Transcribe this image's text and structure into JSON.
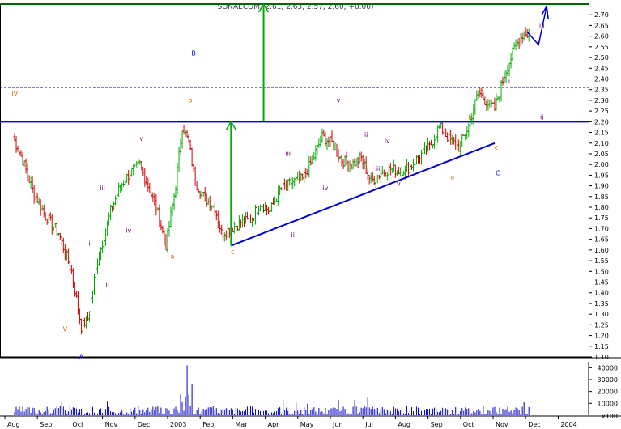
{
  "chart_data": {
    "type": "ohlc-candlestick",
    "title": "SONAECOM (2.61, 2.63, 2.57, 2.60, +0.00)",
    "y_axis": {
      "min": 1.1,
      "max": 2.7,
      "step": 0.05,
      "ticks": [
        "2.70",
        "2.65",
        "2.60",
        "2.55",
        "2.50",
        "2.45",
        "2.40",
        "2.35",
        "2.30",
        "2.25",
        "2.20",
        "2.15",
        "2.10",
        "2.05",
        "2.00",
        "1.95",
        "1.90",
        "1.85",
        "1.80",
        "1.75",
        "1.70",
        "1.65",
        "1.60",
        "1.55",
        "1.50",
        "1.45",
        "1.40",
        "1.35",
        "1.30",
        "1.25",
        "1.20",
        "1.15",
        "1.10"
      ]
    },
    "volume_axis": {
      "min": 0,
      "max": 45000,
      "ticks": [
        "40000",
        "30000",
        "20000",
        "10000"
      ],
      "multiplier_label": "x100"
    },
    "x_axis": {
      "labels": [
        "Aug",
        "Sep",
        "Oct",
        "Nov",
        "Dec",
        "2003",
        "Feb",
        "Mar",
        "Apr",
        "May",
        "Jun",
        "Jul",
        "Aug",
        "Sep",
        "Oct",
        "Nov",
        "Dec",
        "2004"
      ]
    },
    "price_series_anchors": [
      {
        "m": 0.0,
        "p": 2.13
      },
      {
        "m": 0.3,
        "p": 2.02
      },
      {
        "m": 0.6,
        "p": 1.88
      },
      {
        "m": 1.0,
        "p": 1.76
      },
      {
        "m": 1.4,
        "p": 1.68
      },
      {
        "m": 1.8,
        "p": 1.5
      },
      {
        "m": 2.1,
        "p": 1.24
      },
      {
        "m": 2.3,
        "p": 1.28
      },
      {
        "m": 2.6,
        "p": 1.55
      },
      {
        "m": 3.0,
        "p": 1.78
      },
      {
        "m": 3.3,
        "p": 1.9
      },
      {
        "m": 3.6,
        "p": 1.96
      },
      {
        "m": 3.9,
        "p": 2.0
      },
      {
        "m": 4.1,
        "p": 1.92
      },
      {
        "m": 4.4,
        "p": 1.8
      },
      {
        "m": 4.7,
        "p": 1.62
      },
      {
        "m": 5.0,
        "p": 1.9
      },
      {
        "m": 5.2,
        "p": 2.18
      },
      {
        "m": 5.4,
        "p": 2.1
      },
      {
        "m": 5.6,
        "p": 1.92
      },
      {
        "m": 5.9,
        "p": 1.84
      },
      {
        "m": 6.2,
        "p": 1.8
      },
      {
        "m": 6.4,
        "p": 1.68
      },
      {
        "m": 6.7,
        "p": 1.7
      },
      {
        "m": 7.0,
        "p": 1.73
      },
      {
        "m": 7.3,
        "p": 1.74
      },
      {
        "m": 7.6,
        "p": 1.82
      },
      {
        "m": 7.9,
        "p": 1.78
      },
      {
        "m": 8.2,
        "p": 1.88
      },
      {
        "m": 8.6,
        "p": 1.92
      },
      {
        "m": 8.9,
        "p": 1.93
      },
      {
        "m": 9.2,
        "p": 2.02
      },
      {
        "m": 9.5,
        "p": 2.13
      },
      {
        "m": 9.8,
        "p": 2.1
      },
      {
        "m": 10.1,
        "p": 2.02
      },
      {
        "m": 10.4,
        "p": 2.0
      },
      {
        "m": 10.7,
        "p": 2.03
      },
      {
        "m": 11.0,
        "p": 1.92
      },
      {
        "m": 11.3,
        "p": 1.96
      },
      {
        "m": 11.6,
        "p": 1.98
      },
      {
        "m": 11.9,
        "p": 1.97
      },
      {
        "m": 12.2,
        "p": 1.99
      },
      {
        "m": 12.5,
        "p": 2.04
      },
      {
        "m": 12.8,
        "p": 2.08
      },
      {
        "m": 13.1,
        "p": 2.18
      },
      {
        "m": 13.4,
        "p": 2.12
      },
      {
        "m": 13.7,
        "p": 2.08
      },
      {
        "m": 14.0,
        "p": 2.18
      },
      {
        "m": 14.3,
        "p": 2.34
      },
      {
        "m": 14.5,
        "p": 2.3
      },
      {
        "m": 14.8,
        "p": 2.26
      },
      {
        "m": 15.1,
        "p": 2.42
      },
      {
        "m": 15.4,
        "p": 2.54
      },
      {
        "m": 15.7,
        "p": 2.62
      },
      {
        "m": 15.9,
        "p": 2.6
      }
    ],
    "horizontal_lines": [
      {
        "name": "resistance",
        "price": 2.2,
        "style": "solid",
        "color": "#0000cc"
      },
      {
        "name": "target",
        "price": 2.75,
        "style": "solid",
        "color": "#006600"
      },
      {
        "name": "prior-high",
        "price": 2.36,
        "style": "dashed",
        "color": "#000066"
      }
    ],
    "trendline": {
      "from": {
        "m": 6.7,
        "p": 1.62
      },
      "to": {
        "m": 14.8,
        "p": 2.1
      },
      "color": "#0000cc"
    },
    "projection_arrows": [
      {
        "m": 6.7,
        "from": 1.62,
        "to": 2.2
      },
      {
        "m": 7.7,
        "from": 2.2,
        "to": 2.75
      }
    ],
    "wave_labels": [
      {
        "text": "IV",
        "m": 0.05,
        "p": 2.32,
        "color": "#cc6600"
      },
      {
        "text": "V",
        "m": 1.6,
        "p": 1.22,
        "color": "#cc6600"
      },
      {
        "text": "A",
        "m": 2.1,
        "p": 1.09,
        "color": "#0000cc"
      },
      {
        "text": "i",
        "m": 2.35,
        "p": 1.62,
        "color": "#660066"
      },
      {
        "text": "ii",
        "m": 2.9,
        "p": 1.43,
        "color": "#660066"
      },
      {
        "text": "iii",
        "m": 2.75,
        "p": 1.88,
        "color": "#660066"
      },
      {
        "text": "iv",
        "m": 3.55,
        "p": 1.68,
        "color": "#660066"
      },
      {
        "text": "v",
        "m": 3.95,
        "p": 2.11,
        "color": "#660066"
      },
      {
        "text": "a",
        "m": 4.9,
        "p": 1.56,
        "color": "#cc6600"
      },
      {
        "text": "b",
        "m": 5.45,
        "p": 2.29,
        "color": "#cc6600"
      },
      {
        "text": "B",
        "m": 5.55,
        "p": 2.51,
        "color": "#0000cc"
      },
      {
        "text": "c",
        "m": 6.75,
        "p": 1.58,
        "color": "#cc6600"
      },
      {
        "text": "i",
        "m": 7.65,
        "p": 1.98,
        "color": "#660066"
      },
      {
        "text": "ii",
        "m": 8.6,
        "p": 1.66,
        "color": "#660066"
      },
      {
        "text": "iii",
        "m": 8.45,
        "p": 2.04,
        "color": "#660066"
      },
      {
        "text": "iv",
        "m": 9.6,
        "p": 1.88,
        "color": "#660066"
      },
      {
        "text": "v",
        "m": 10.0,
        "p": 2.29,
        "color": "#660066"
      },
      {
        "text": "i",
        "m": 10.6,
        "p": 2.0,
        "color": "#660066"
      },
      {
        "text": "ii",
        "m": 10.85,
        "p": 2.13,
        "color": "#660066"
      },
      {
        "text": "iii",
        "m": 11.25,
        "p": 1.97,
        "color": "#660066"
      },
      {
        "text": "iv",
        "m": 11.5,
        "p": 2.1,
        "color": "#660066"
      },
      {
        "text": "v",
        "m": 11.85,
        "p": 1.9,
        "color": "#660066"
      },
      {
        "text": "a",
        "m": 13.5,
        "p": 1.93,
        "color": "#cc6600"
      },
      {
        "text": "b",
        "m": 14.05,
        "p": 2.21,
        "color": "#cc6600"
      },
      {
        "text": "c",
        "m": 14.85,
        "p": 2.07,
        "color": "#cc6600"
      },
      {
        "text": "C",
        "m": 14.9,
        "p": 1.95,
        "color": "#0000cc"
      },
      {
        "text": "i",
        "m": 15.25,
        "p": 2.38,
        "color": "#660066"
      },
      {
        "text": "ii",
        "m": 16.25,
        "p": 2.21,
        "color": "#660066"
      },
      {
        "text": "iii",
        "m": 16.25,
        "p": 2.64,
        "color": "#660066"
      }
    ],
    "colors": {
      "up": "#00aa00",
      "down": "#cc0000",
      "volume": "#0000cc",
      "axis": "#000000"
    }
  }
}
